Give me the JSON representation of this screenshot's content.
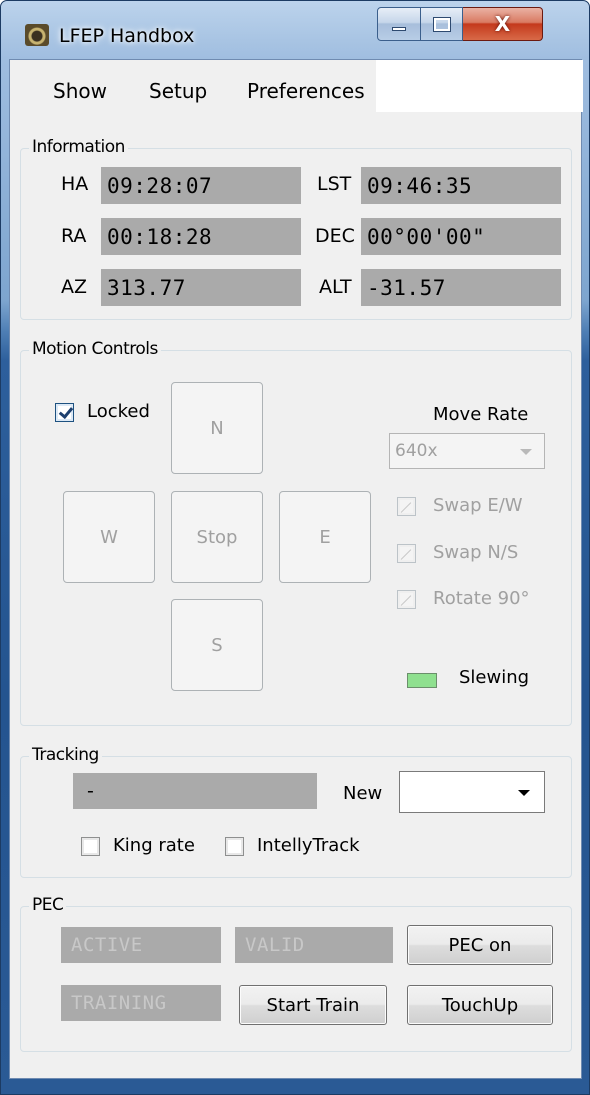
{
  "window": {
    "title": "LFEP Handbox",
    "close_glyph": "X"
  },
  "menu": [
    {
      "label": "Show"
    },
    {
      "label": "Setup"
    },
    {
      "label": "Preferences"
    }
  ],
  "information": {
    "group_label": "Information",
    "ha": {
      "label": "HA",
      "value": "09:28:07"
    },
    "lst": {
      "label": "LST",
      "value": "09:46:35"
    },
    "ra": {
      "label": "RA",
      "value": "00:18:28"
    },
    "dec": {
      "label": "DEC",
      "value": "00°00'00\""
    },
    "az": {
      "label": "AZ",
      "value": "313.77"
    },
    "alt": {
      "label": "ALT",
      "value": "-31.57"
    }
  },
  "motion": {
    "group_label": "Motion Controls",
    "locked": {
      "label": "Locked",
      "checked": true
    },
    "buttons": {
      "n": "N",
      "w": "W",
      "stop": "Stop",
      "e": "E",
      "s": "S"
    },
    "move_rate": {
      "label": "Move Rate",
      "value": "640x"
    },
    "swap_ew": {
      "label": "Swap E/W",
      "checked": false
    },
    "swap_ns": {
      "label": "Swap N/S",
      "checked": false
    },
    "rotate90": {
      "label": "Rotate 90°",
      "checked": false
    },
    "slewing": {
      "label": "Slewing",
      "led_color": "#8fe08f"
    }
  },
  "tracking": {
    "group_label": "Tracking",
    "current": "-",
    "new_label": "New",
    "new_value": "",
    "king_rate": {
      "label": "King rate",
      "checked": false
    },
    "intellytrack": {
      "label": "IntellyTrack",
      "checked": false
    }
  },
  "pec": {
    "group_label": "PEC",
    "active": "ACTIVE",
    "valid": "VALID",
    "training": "TRAINING",
    "pec_on": "PEC on",
    "start_train": "Start Train",
    "touchup": "TouchUp"
  }
}
